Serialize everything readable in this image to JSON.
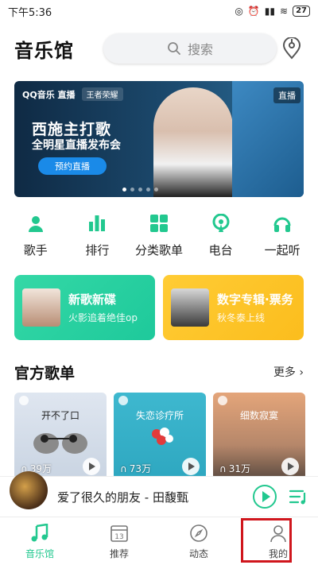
{
  "status_bar": {
    "time": "下午5:36",
    "battery": "27"
  },
  "header": {
    "title": "音乐馆",
    "search_placeholder": "搜索"
  },
  "banner": {
    "logo_left": "QQ音乐 直播",
    "logo_right": "王者荣耀",
    "title": "西施主打歌",
    "subtitle": "全明星直播发布会",
    "button": "预约直播",
    "tag": "直播"
  },
  "quick_nav": [
    {
      "label": "歌手",
      "icon": "singer-icon"
    },
    {
      "label": "排行",
      "icon": "chart-icon"
    },
    {
      "label": "分类歌单",
      "icon": "category-icon"
    },
    {
      "label": "电台",
      "icon": "radio-icon"
    },
    {
      "label": "一起听",
      "icon": "headphones-icon"
    }
  ],
  "cards": [
    {
      "title": "新歌新碟",
      "subtitle": "火影追着绝佳op",
      "color": "#1ec99b"
    },
    {
      "title": "数字专辑·票务",
      "subtitle": "秋冬泰上线",
      "color": "#fbbd1d"
    }
  ],
  "section": {
    "title": "官方歌单",
    "more": "更多"
  },
  "playlists": [
    {
      "title": "开不了口",
      "count": "39万"
    },
    {
      "title": "失恋诊疗所",
      "count": "73万"
    },
    {
      "title": "细数寂寞",
      "count": "31万"
    }
  ],
  "mini_player": {
    "song": "爱了很久的朋友 - 田馥甄"
  },
  "tabs": [
    {
      "label": "音乐馆",
      "icon": "music-note-icon",
      "active": true
    },
    {
      "label": "推荐",
      "icon": "calendar-icon",
      "day": "13",
      "active": false
    },
    {
      "label": "动态",
      "icon": "compass-icon",
      "active": false
    },
    {
      "label": "我的",
      "icon": "profile-icon",
      "active": false
    }
  ],
  "colors": {
    "accent": "#22c88f",
    "highlight": "#d0161d"
  }
}
